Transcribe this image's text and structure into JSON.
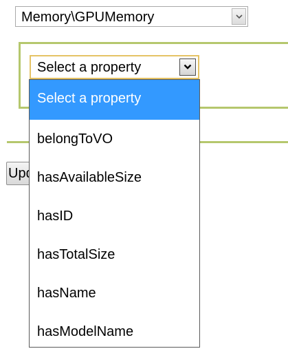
{
  "class_select": {
    "value": "Memory\\GPUMemory"
  },
  "update_button": {
    "label": "Update"
  },
  "property_select": {
    "value": "Select a property",
    "options": [
      "Select a property",
      "belongToVO",
      "hasAvailableSize",
      "hasID",
      "hasTotalSize",
      "hasName",
      "hasModelName"
    ],
    "highlighted_index": 0
  },
  "icons": {
    "dropdown_arrow": "chevron-down-icon"
  },
  "colors": {
    "panel_border": "#b5c76d",
    "focus_border": "#e5c365",
    "highlight": "#3399ff"
  }
}
